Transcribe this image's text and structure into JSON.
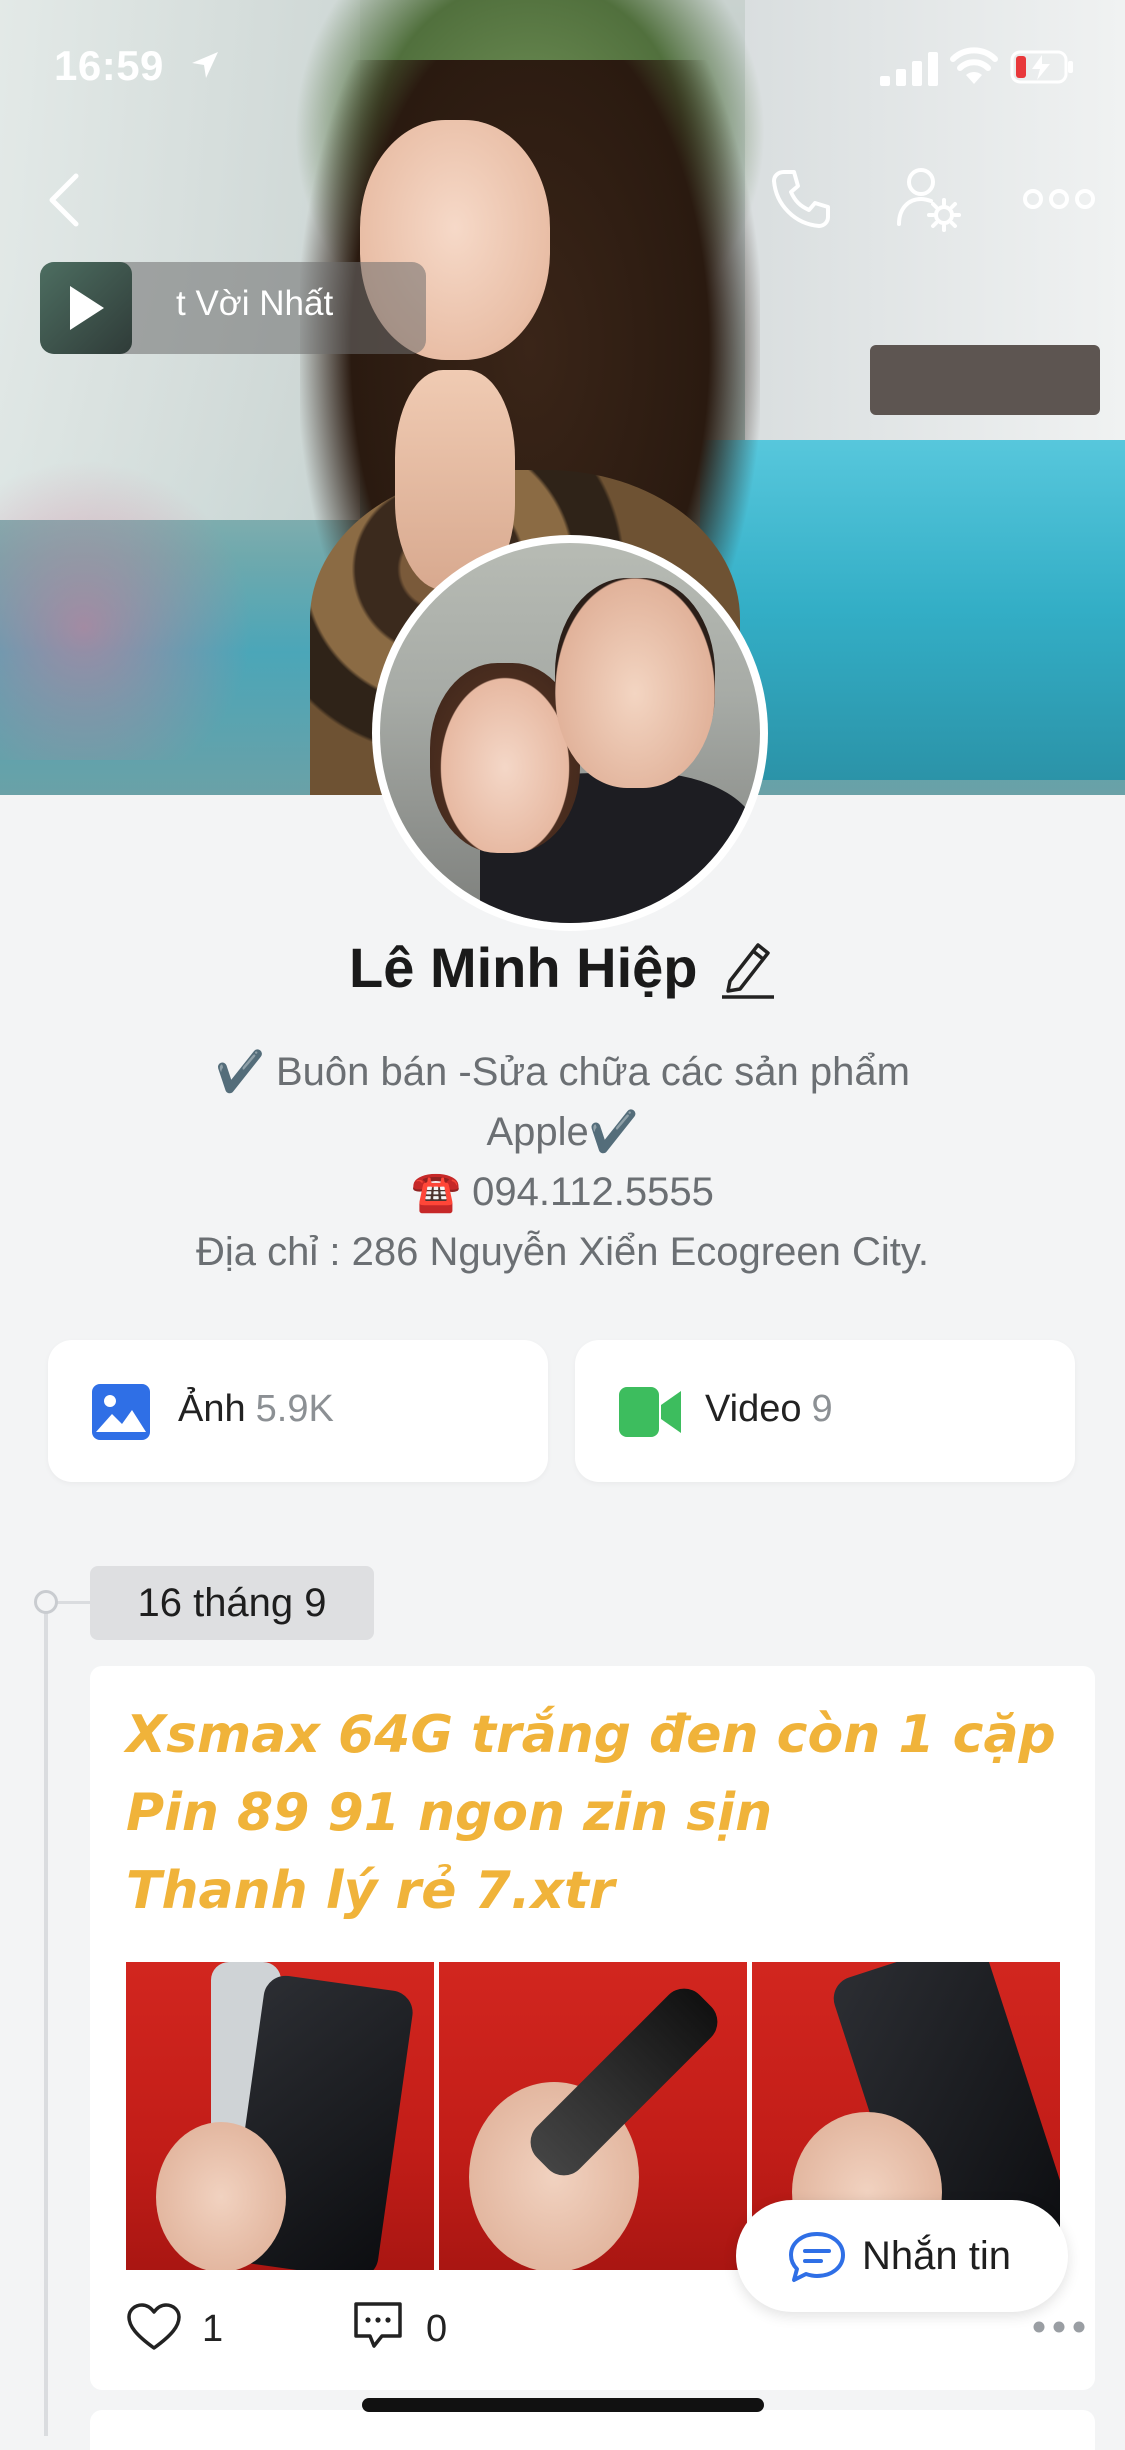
{
  "status_bar": {
    "time": "16:59"
  },
  "music": {
    "title": "t Vời Nhất"
  },
  "profile": {
    "name": "Lê Minh Hiệp",
    "bio_lines": [
      "✔️ Buôn bán -Sửa chữa các sản phẩm",
      "Apple✔️",
      "☎️ 094.112.5555",
      "Địa chỉ : 286 Nguyễn Xiển Ecogreen City."
    ]
  },
  "media": {
    "photo": {
      "label": "Ảnh",
      "count": "5.9K"
    },
    "video": {
      "label": "Video",
      "count": "9"
    }
  },
  "timeline": {
    "date": "16 tháng 9",
    "post": {
      "text_lines": [
        "Xsmax 64G trắng đen còn 1 cặp",
        "Pin 89 91 ngon zin sịn",
        "Thanh lý rẻ 7.xtr"
      ],
      "likes": "1",
      "comments": "0"
    }
  },
  "message_button": {
    "label": "Nhắn tin"
  },
  "colors": {
    "post_text": "#f0b33a",
    "photo_icon": "#2f6fe6",
    "video_icon": "#3dbd5e",
    "message_icon": "#2f6fe6",
    "background": "#f3f4f5"
  },
  "icons": [
    "back-icon",
    "phone-icon",
    "profile-settings-icon",
    "more-icon",
    "play-icon",
    "edit-icon",
    "photo-icon",
    "video-icon",
    "heart-icon",
    "comment-icon",
    "chat-bubble-icon",
    "location-arrow-icon",
    "signal-icon",
    "wifi-icon",
    "battery-icon"
  ]
}
